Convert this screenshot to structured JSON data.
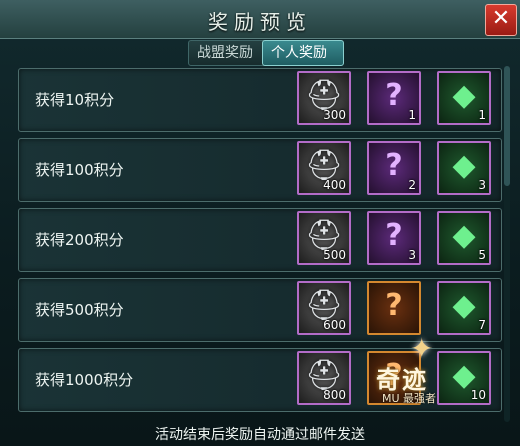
{
  "header": {
    "title": "奖励预览",
    "close_glyph": "✕"
  },
  "tabs": [
    {
      "label": "战盟奖励",
      "active": false
    },
    {
      "label": "个人奖励",
      "active": true
    }
  ],
  "rewards": [
    {
      "label": "获得10积分",
      "items": [
        {
          "icon": "silver-helmet-icon",
          "qty": "300"
        },
        {
          "icon": "purple-mystery-scroll-icon",
          "qty": "1"
        },
        {
          "icon": "green-gem-icon",
          "qty": "1"
        }
      ]
    },
    {
      "label": "获得100积分",
      "items": [
        {
          "icon": "silver-helmet-icon",
          "qty": "400"
        },
        {
          "icon": "purple-mystery-scroll-icon",
          "qty": "2"
        },
        {
          "icon": "green-gem-icon",
          "qty": "3"
        }
      ]
    },
    {
      "label": "获得200积分",
      "items": [
        {
          "icon": "silver-helmet-icon",
          "qty": "500"
        },
        {
          "icon": "purple-mystery-scroll-icon",
          "qty": "3"
        },
        {
          "icon": "green-gem-icon",
          "qty": "5"
        }
      ]
    },
    {
      "label": "获得500积分",
      "items": [
        {
          "icon": "silver-helmet-icon",
          "qty": "600"
        },
        {
          "icon": "orange-mystery-scroll-icon",
          "qty": ""
        },
        {
          "icon": "green-gem-icon",
          "qty": "7"
        }
      ]
    },
    {
      "label": "获得1000积分",
      "items": [
        {
          "icon": "silver-helmet-icon",
          "qty": "800"
        },
        {
          "icon": "orange-mystery-scroll-icon",
          "qty": ""
        },
        {
          "icon": "green-gem-icon",
          "qty": "10"
        }
      ]
    }
  ],
  "footer": {
    "note": "活动结束后奖励自动通过邮件发送"
  },
  "watermark": {
    "text": "奇迹",
    "sub": "MU 最强者"
  },
  "colors": {
    "accent_tab": "#2f7a80",
    "close_red": "#c42a1e",
    "slot_purple": "#b36cc8",
    "slot_orange": "#d4882f"
  }
}
